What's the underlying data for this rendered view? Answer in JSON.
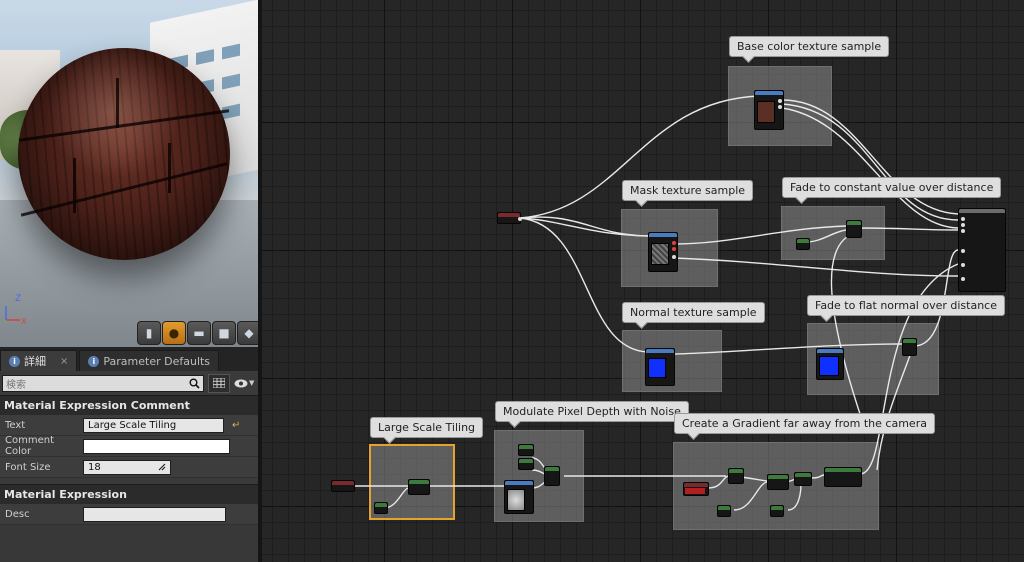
{
  "viewport": {
    "axis": {
      "z": "Z",
      "x": "X"
    },
    "buttons": [
      {
        "name": "cylinder-preview-icon",
        "glyph": "▮"
      },
      {
        "name": "sphere-preview-icon",
        "glyph": "●",
        "active": true
      },
      {
        "name": "plane-preview-icon",
        "glyph": "▬"
      },
      {
        "name": "cube-preview-icon",
        "glyph": "■"
      },
      {
        "name": "mesh-preview-icon",
        "glyph": "◆"
      }
    ]
  },
  "details": {
    "tabs": [
      {
        "label": "詳細",
        "close": "×"
      },
      {
        "label": "Parameter Defaults",
        "close": ""
      }
    ],
    "search_placeholder": "検索",
    "sections": {
      "comment": {
        "header": "Material Expression Comment",
        "text_label": "Text",
        "text_value": "Large Scale Tiling",
        "reset_glyph": "↵",
        "color_label": "Comment Color",
        "size_label": "Font Size",
        "size_value": "18"
      },
      "expression": {
        "header": "Material Expression",
        "desc_label": "Desc",
        "desc_value": ""
      }
    }
  },
  "graph": {
    "comments": [
      {
        "id": "base-color",
        "title": "Base color texture sample"
      },
      {
        "id": "mask",
        "title": "Mask texture sample"
      },
      {
        "id": "fade-constant",
        "title": "Fade to constant value over distance"
      },
      {
        "id": "normal",
        "title": "Normal texture sample"
      },
      {
        "id": "fade-flat",
        "title": "Fade to flat normal over distance"
      },
      {
        "id": "large-scale",
        "title": "Large Scale Tiling"
      },
      {
        "id": "modulate",
        "title": "Modulate Pixel Depth with Noise"
      },
      {
        "id": "gradient",
        "title": "Create a Gradient far away from the camera"
      }
    ],
    "colors": {
      "selected_outline": "#e4a32d",
      "texture_node_header": "#4a7bbf",
      "param_node_header": "#7a2a2a",
      "math_node_header": "#3d7a3d",
      "output_node_header": "#6b6b6b",
      "normal_preview": "#1030ff"
    }
  }
}
